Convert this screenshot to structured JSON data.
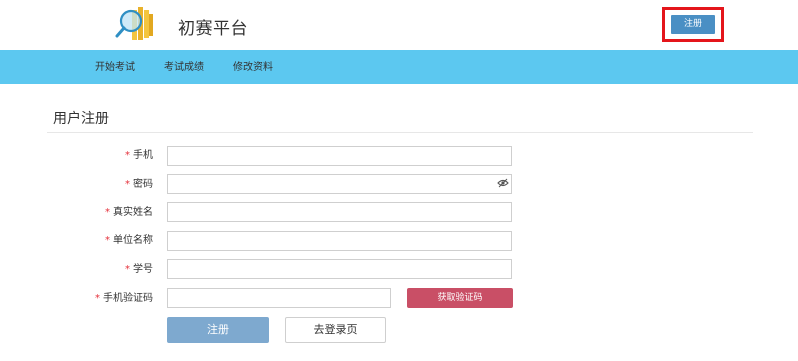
{
  "header": {
    "logo_icon": "books-magnifier-logo-icon",
    "site_title": "初赛平台",
    "register_label": "注册",
    "highlight_color": "#e4151b",
    "button_color": "#4a8fc4"
  },
  "nav": {
    "background_color": "#5cc8f0",
    "items": [
      {
        "label": "开始考试"
      },
      {
        "label": "考试成绩"
      },
      {
        "label": "修改资料"
      }
    ]
  },
  "form": {
    "section_title": "用户注册",
    "required_mark": "*",
    "fields": [
      {
        "label": "手机",
        "value": "",
        "placeholder": ""
      },
      {
        "label": "密码",
        "value": "",
        "placeholder": "",
        "icon": "eye-toggle-icon"
      },
      {
        "label": "真实姓名",
        "value": "",
        "placeholder": ""
      },
      {
        "label": "单位名称",
        "value": "",
        "placeholder": ""
      },
      {
        "label": "学号",
        "value": "",
        "placeholder": ""
      },
      {
        "label": "手机验证码",
        "value": "",
        "placeholder": ""
      }
    ],
    "get_code_label": "获取验证码",
    "get_code_color": "#c94f66",
    "submit_label": "注册",
    "submit_color": "#7ea9cf",
    "go_login_label": "去登录页"
  }
}
